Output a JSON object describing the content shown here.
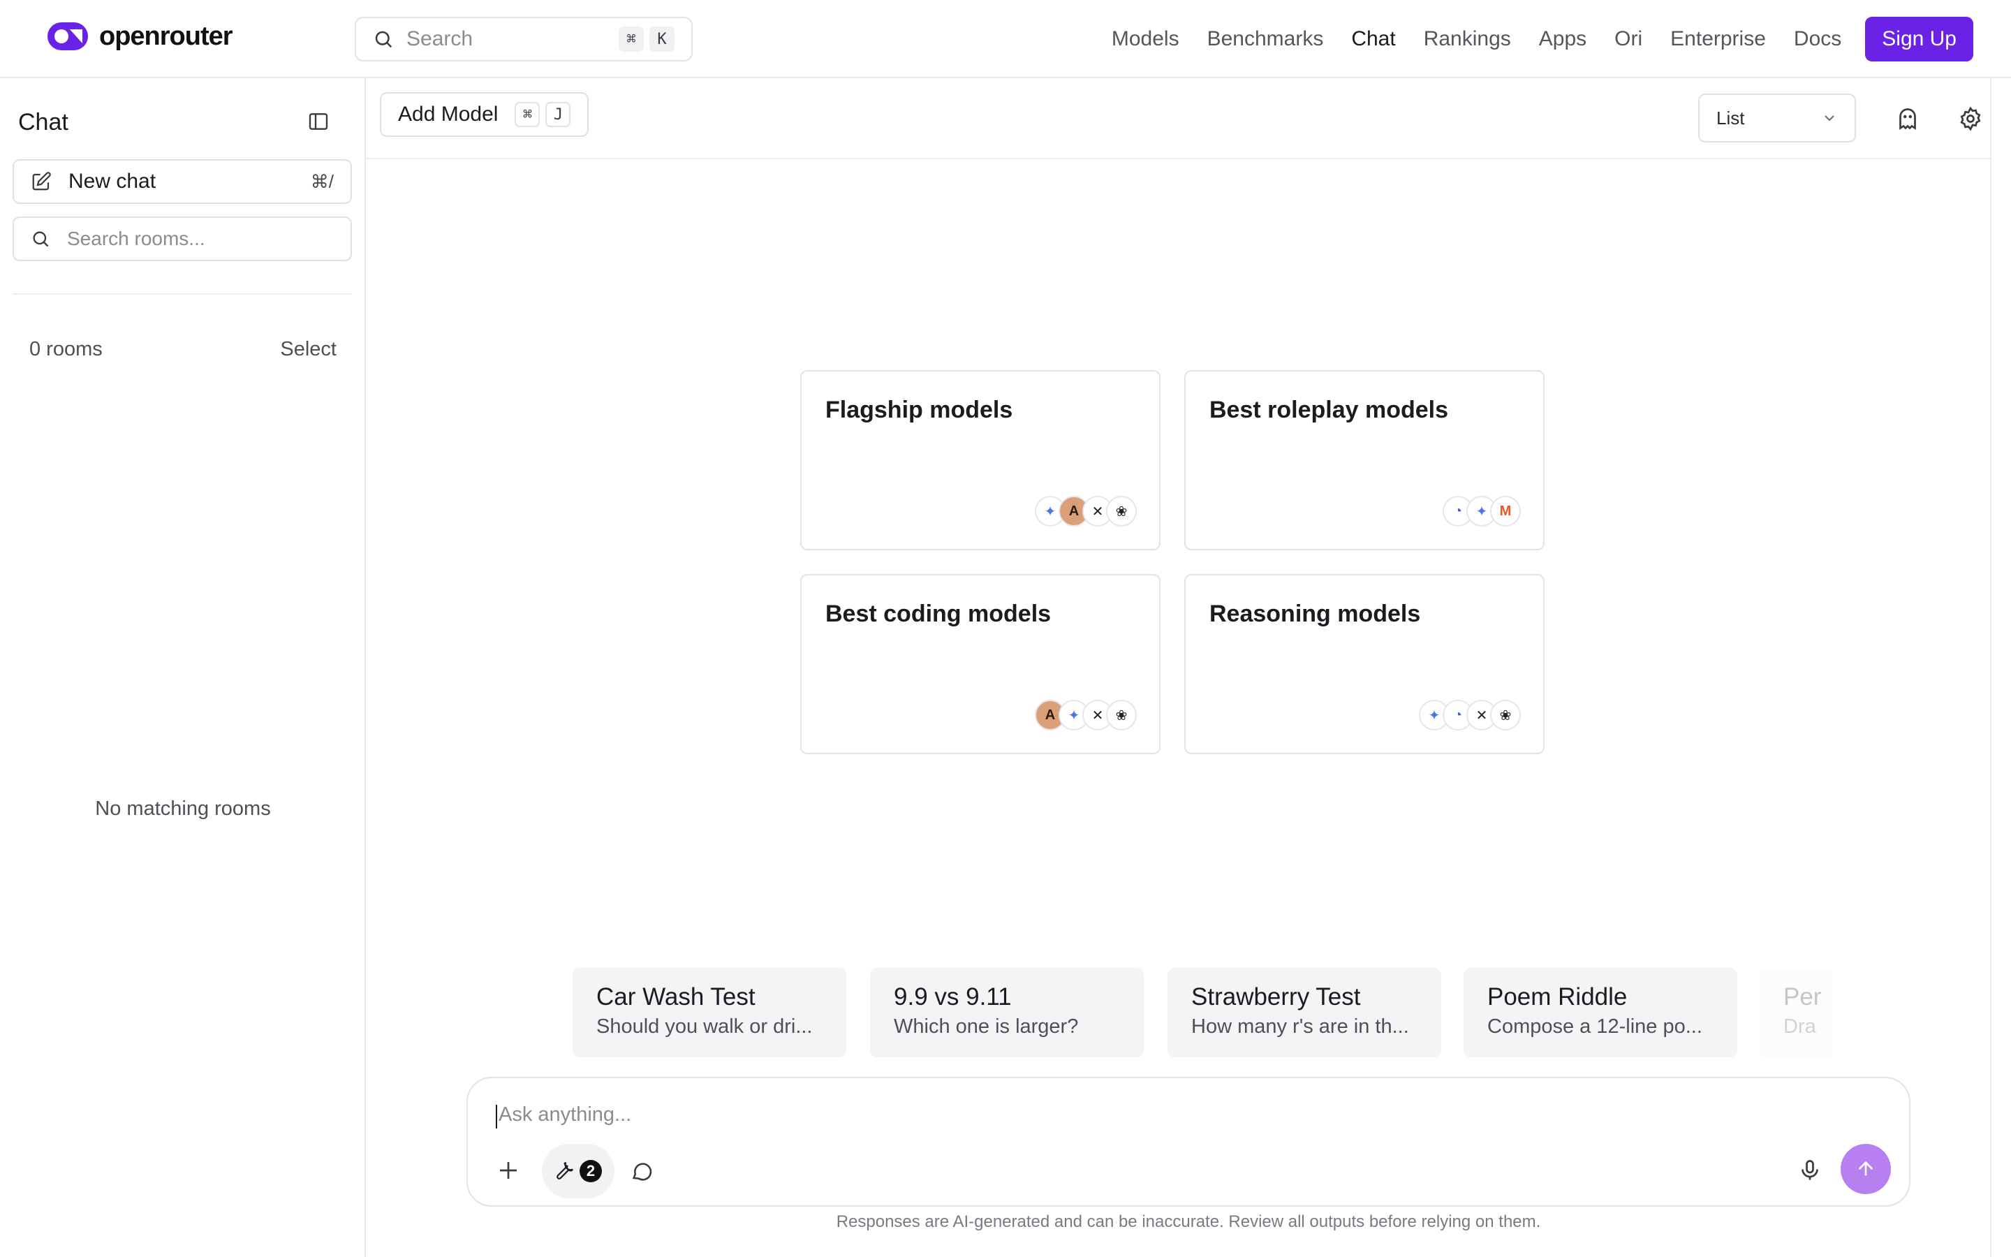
{
  "brand": {
    "name": "openrouter",
    "accent": "#6a23e6"
  },
  "top_search": {
    "placeholder": "Search",
    "kbd1": "⌘",
    "kbd2": "K"
  },
  "nav": {
    "items": [
      "Models",
      "Benchmarks",
      "Chat",
      "Rankings",
      "Apps",
      "Ori",
      "Enterprise",
      "Docs"
    ],
    "active": "Chat",
    "signup": "Sign Up"
  },
  "sidebar": {
    "title": "Chat",
    "new_chat": "New chat",
    "new_chat_shortcut": "⌘/",
    "search_placeholder": "Search rooms...",
    "rooms_count": "0 rooms",
    "select": "Select",
    "empty": "No matching rooms"
  },
  "main": {
    "add_model": "Add Model",
    "add_model_kbd1": "⌘",
    "add_model_kbd2": "J",
    "view_select": "List"
  },
  "cards": [
    {
      "title": "Flagship models",
      "icons": [
        "gemini-icon",
        "anthropic-icon",
        "xai-icon",
        "openai-icon"
      ]
    },
    {
      "title": "Best roleplay models",
      "icons": [
        "deepseek-icon",
        "gemini-icon",
        "mistral-icon"
      ]
    },
    {
      "title": "Best coding models",
      "icons": [
        "anthropic-icon",
        "gemini-icon",
        "xai-icon",
        "openai-icon"
      ]
    },
    {
      "title": "Reasoning models",
      "icons": [
        "gemini-icon",
        "deepseek-icon",
        "xai-icon",
        "openai-icon"
      ]
    }
  ],
  "prompts": [
    {
      "title": "Car Wash Test",
      "desc": "Should you walk or dri..."
    },
    {
      "title": "9.9 vs 9.11",
      "desc": "Which one is larger?"
    },
    {
      "title": "Strawberry Test",
      "desc": "How many r's are in th..."
    },
    {
      "title": "Poem Riddle",
      "desc": "Compose a 12-line po..."
    },
    {
      "title": "Per",
      "desc": "Dra"
    }
  ],
  "composer": {
    "placeholder": "Ask anything...",
    "tools_count": "2",
    "disclaimer": "Responses are AI-generated and can be inaccurate. Review all outputs before relying on them."
  }
}
